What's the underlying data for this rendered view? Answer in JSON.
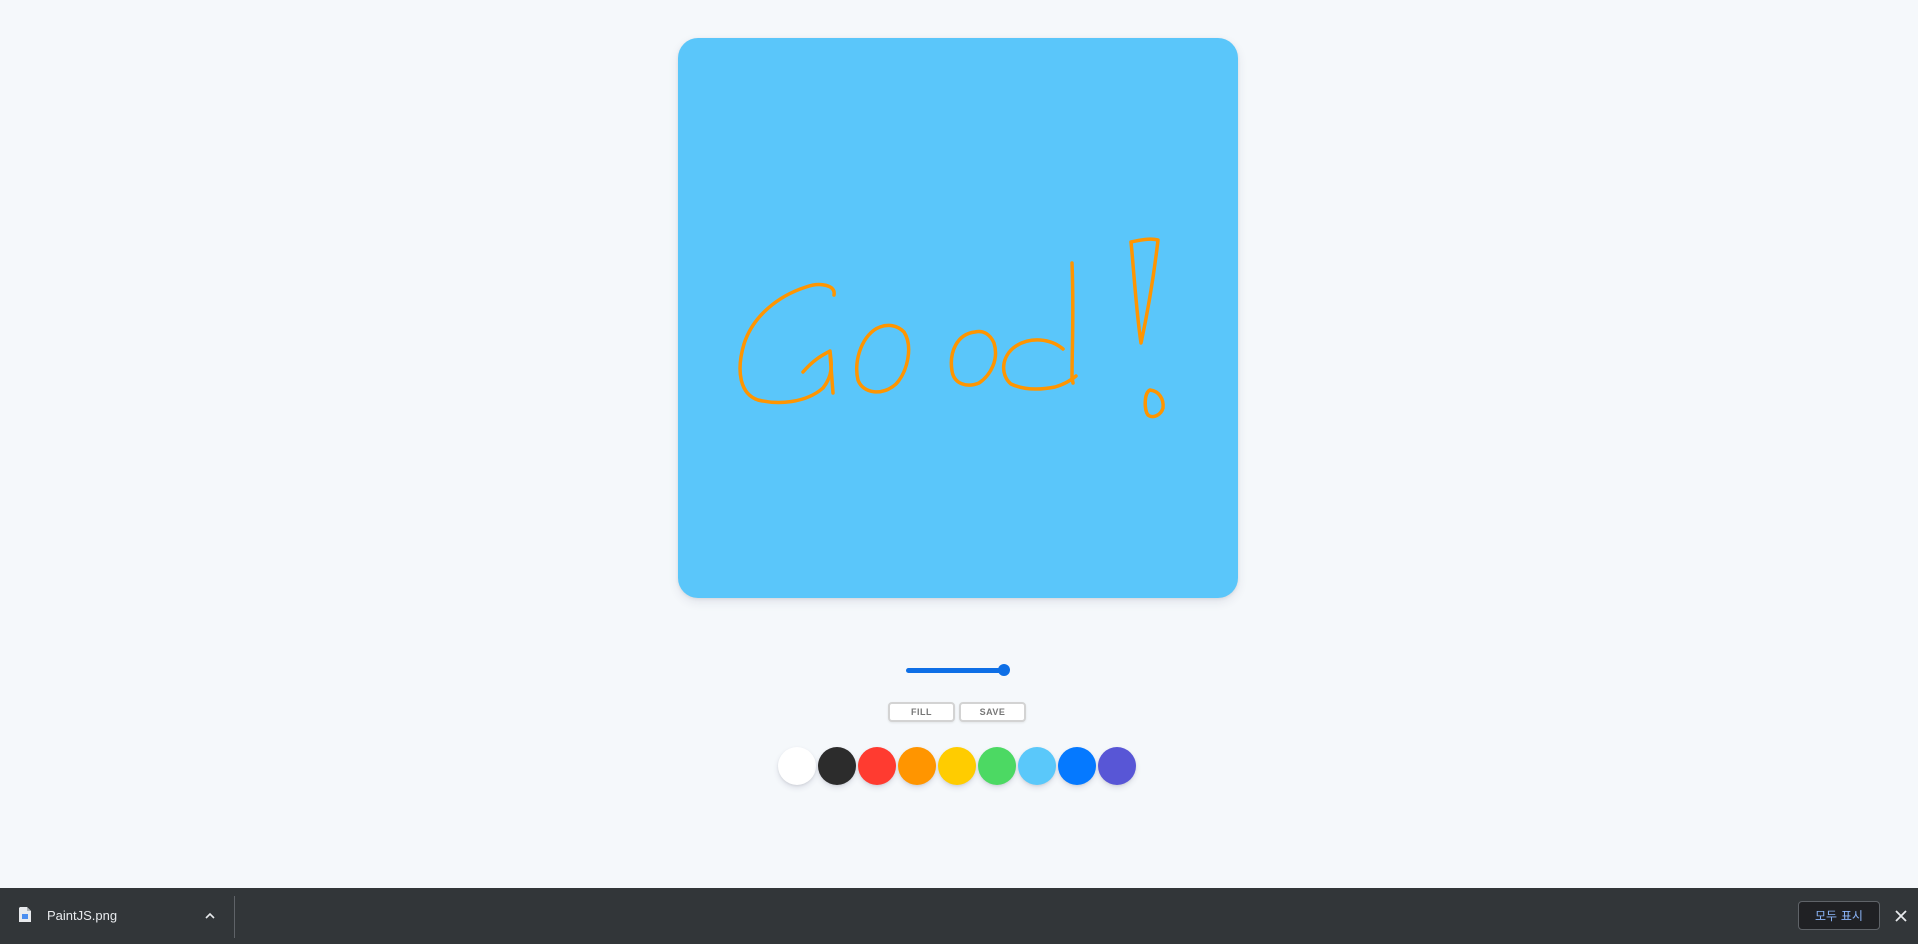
{
  "canvas": {
    "background": "#5ac6fa",
    "stroke_color": "#ff9500",
    "drawing_text": "Good!"
  },
  "brush_range": {
    "value_fraction": 1.0,
    "accent": "#0e6fe6"
  },
  "controls": {
    "fill_label": "FILL",
    "save_label": "SAVE"
  },
  "palette": [
    "#ffffff",
    "#2c2c2c",
    "#ff3b30",
    "#ff9500",
    "#ffcc00",
    "#4cd963",
    "#5ac8fa",
    "#0579ff",
    "#5856d6"
  ],
  "download_bar": {
    "file_name": "PaintJS.png",
    "show_all_label": "모두 표시",
    "icons": [
      "file-icon",
      "chevron-up-icon",
      "close-icon"
    ]
  }
}
